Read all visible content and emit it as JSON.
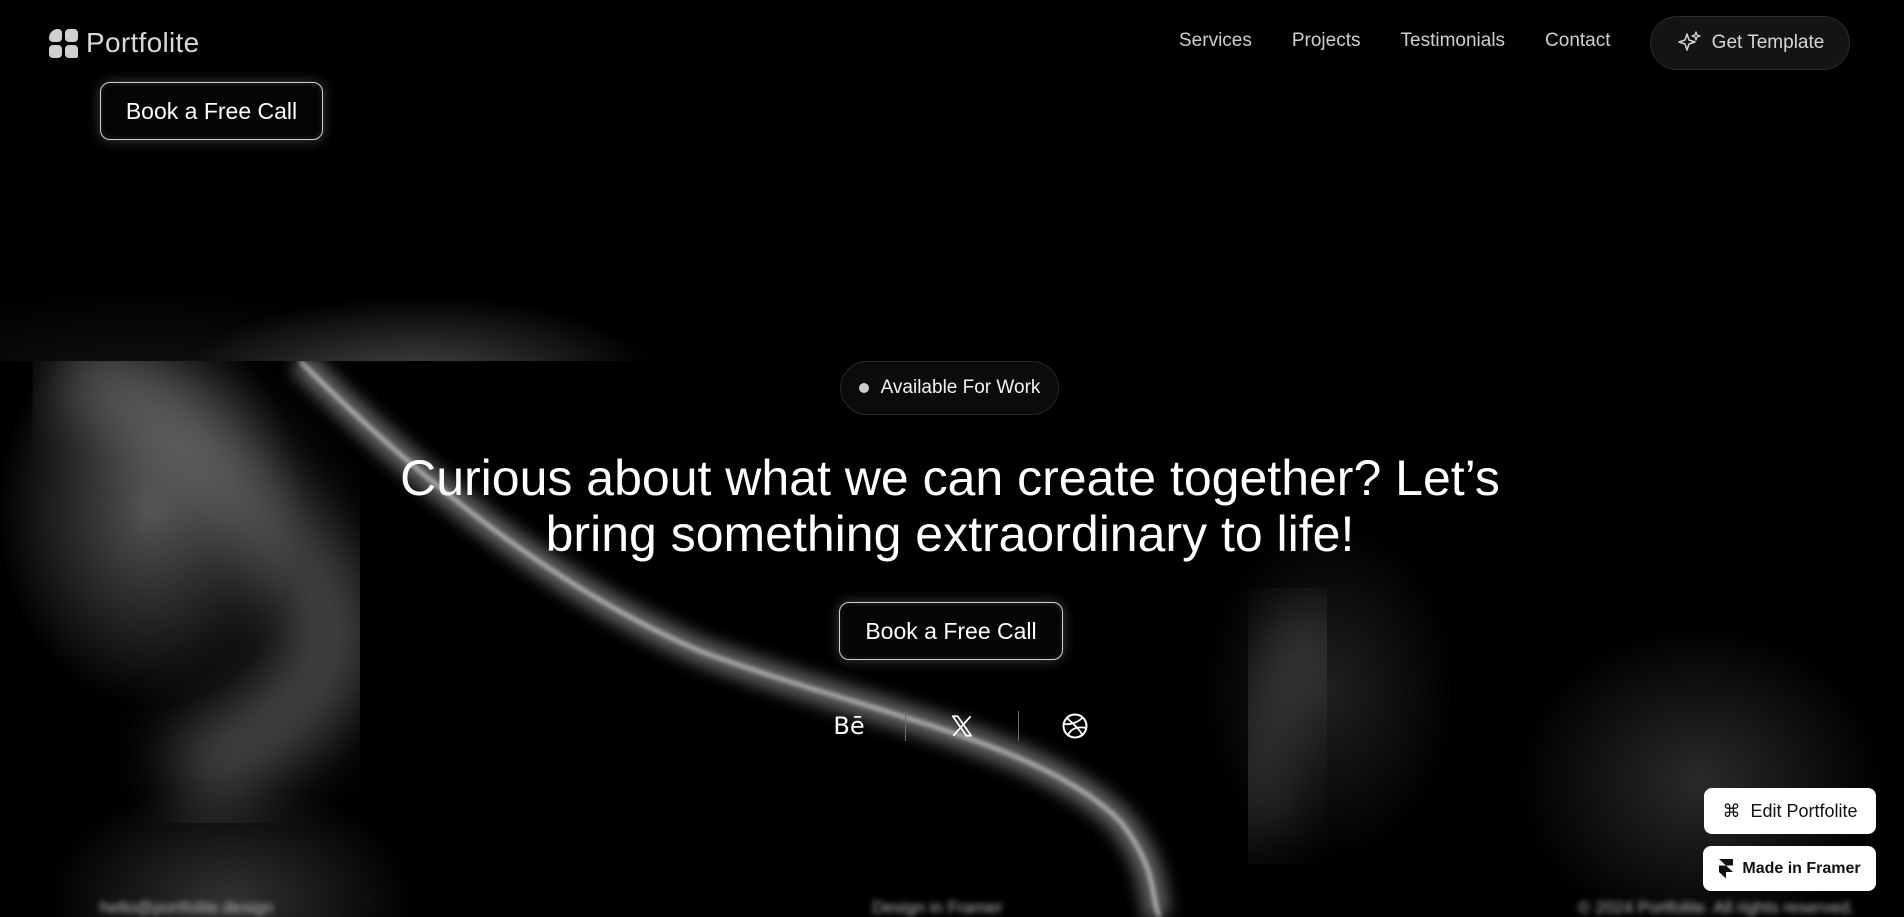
{
  "brand": {
    "name": "Portfolite",
    "icon": "grid-logo-icon"
  },
  "nav": {
    "links": [
      "Services",
      "Projects",
      "Testimonials",
      "Contact"
    ],
    "cta_label": "Get Template",
    "cta_icon": "sparkle-icon"
  },
  "hero_top": {
    "cta_label": "Book a Free Call"
  },
  "contact": {
    "badge": "Available For Work",
    "headline_line1": "Curious about what we can create together? Let’s",
    "headline_line2": "bring something extraordinary to life!",
    "cta_label": "Book a Free Call",
    "socials": [
      {
        "label": "Bē",
        "icon": "behance-icon"
      },
      {
        "label": "𝕏",
        "icon": "x-twitter-icon"
      },
      {
        "label": "",
        "icon": "dribbble-icon"
      }
    ]
  },
  "overlay": {
    "edit_label": "Edit Portfolite",
    "edit_icon": "command-icon",
    "framer_label": "Made in Framer",
    "framer_icon": "framer-logo-icon"
  },
  "footer": {
    "email": "hello@portfolite.design",
    "credit": "Design in Framer",
    "copyright": "© 2024 Portfolite. All rights reserved."
  },
  "colors": {
    "background": "#000000",
    "text": "#ffffff",
    "muted": "#cfcfcf"
  }
}
